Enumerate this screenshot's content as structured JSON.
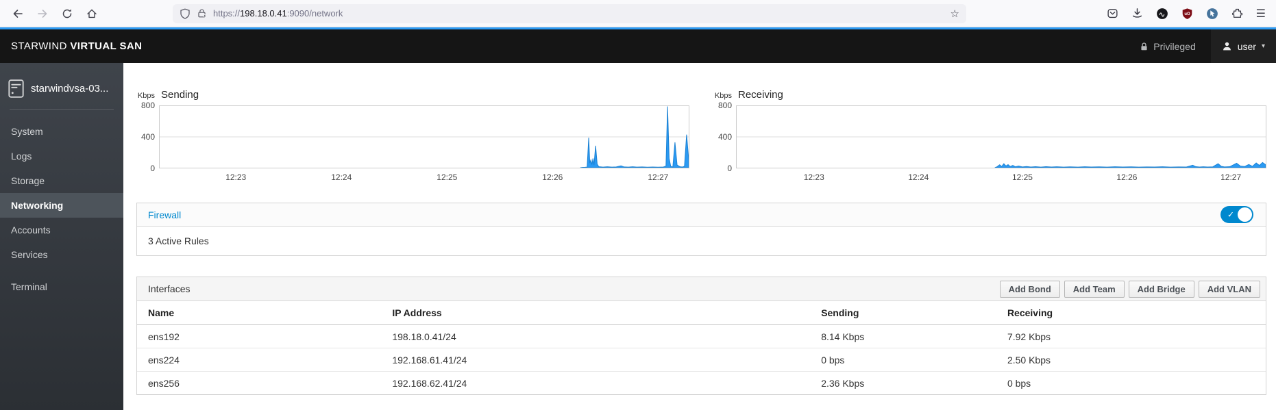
{
  "colors": {
    "accent": "#2b9af3",
    "chart_fill": "#2b9af3",
    "chart_stroke": "#1b82d4",
    "link": "#0088ce",
    "toggle_on": "#0088ce",
    "grid": "#dddddd"
  },
  "icons": {
    "star_glyph": "☆",
    "menu_glyph": "☰",
    "caret_glyph": "▾",
    "check_glyph": "✓"
  },
  "browser": {
    "url_prefix": "https://",
    "url_host": "198.18.0.41",
    "url_suffix": ":9090/network"
  },
  "masthead": {
    "brand_normal": "STARWIND",
    "brand_bold": "VIRTUAL SAN",
    "privileged_label": "Privileged",
    "user_label": "user"
  },
  "sidebar": {
    "hostname": "starwindvsa-03...",
    "items": [
      {
        "label": "System",
        "active": false
      },
      {
        "label": "Logs",
        "active": false
      },
      {
        "label": "Storage",
        "active": false
      },
      {
        "label": "Networking",
        "active": true
      },
      {
        "label": "Accounts",
        "active": false
      },
      {
        "label": "Services",
        "active": false
      },
      {
        "label": "Terminal",
        "active": false,
        "gap_before": true
      }
    ]
  },
  "firewall": {
    "title": "Firewall",
    "summary": "3 Active Rules",
    "toggle_on": true
  },
  "interfaces": {
    "title": "Interfaces",
    "buttons": [
      "Add Bond",
      "Add Team",
      "Add Bridge",
      "Add VLAN"
    ],
    "columns": [
      "Name",
      "IP Address",
      "Sending",
      "Receiving"
    ],
    "rows": [
      [
        "ens192",
        "198.18.0.41/24",
        "8.14 Kbps",
        "7.92 Kbps"
      ],
      [
        "ens224",
        "192.168.61.41/24",
        "0 bps",
        "2.50 Kbps"
      ],
      [
        "ens256",
        "192.168.62.41/24",
        "2.36 Kbps",
        "0 bps"
      ]
    ]
  },
  "chart_data": [
    {
      "type": "area",
      "title": "Sending",
      "unit": "Kbps",
      "ylabel": "Kbps",
      "ylim": [
        0,
        800
      ],
      "yticks": [
        0,
        400,
        800
      ],
      "grid": true,
      "legend": "none",
      "xticks": [
        {
          "label": "12:23",
          "f": 0.145
        },
        {
          "label": "12:24",
          "f": 0.344
        },
        {
          "label": "12:25",
          "f": 0.543
        },
        {
          "label": "12:26",
          "f": 0.742
        },
        {
          "label": "12:27",
          "f": 0.941
        }
      ],
      "series": [
        {
          "name": "Sending",
          "points": [
            [
              0.795,
              0
            ],
            [
              0.8,
              4
            ],
            [
              0.804,
              6
            ],
            [
              0.808,
              8
            ],
            [
              0.811,
              390
            ],
            [
              0.813,
              60
            ],
            [
              0.815,
              100
            ],
            [
              0.817,
              40
            ],
            [
              0.819,
              120
            ],
            [
              0.821,
              35
            ],
            [
              0.824,
              285
            ],
            [
              0.827,
              45
            ],
            [
              0.83,
              14
            ],
            [
              0.838,
              8
            ],
            [
              0.846,
              12
            ],
            [
              0.855,
              8
            ],
            [
              0.863,
              10
            ],
            [
              0.872,
              24
            ],
            [
              0.878,
              10
            ],
            [
              0.886,
              8
            ],
            [
              0.894,
              12
            ],
            [
              0.902,
              8
            ],
            [
              0.912,
              10
            ],
            [
              0.922,
              7
            ],
            [
              0.932,
              9
            ],
            [
              0.942,
              7
            ],
            [
              0.952,
              9
            ],
            [
              0.957,
              20
            ],
            [
              0.96,
              795
            ],
            [
              0.963,
              120
            ],
            [
              0.966,
              18
            ],
            [
              0.97,
              10
            ],
            [
              0.974,
              330
            ],
            [
              0.978,
              35
            ],
            [
              0.983,
              14
            ],
            [
              0.988,
              9
            ],
            [
              0.992,
              18
            ],
            [
              0.996,
              430
            ],
            [
              1.0,
              110
            ]
          ]
        }
      ]
    },
    {
      "type": "area",
      "title": "Receiving",
      "unit": "Kbps",
      "ylabel": "Kbps",
      "ylim": [
        0,
        800
      ],
      "yticks": [
        0,
        400,
        800
      ],
      "grid": true,
      "legend": "none",
      "xticks": [
        {
          "label": "12:23",
          "f": 0.147
        },
        {
          "label": "12:24",
          "f": 0.344
        },
        {
          "label": "12:25",
          "f": 0.54
        },
        {
          "label": "12:26",
          "f": 0.737
        },
        {
          "label": "12:27",
          "f": 0.933
        }
      ],
      "series": [
        {
          "name": "Receiving",
          "points": [
            [
              0.488,
              0
            ],
            [
              0.492,
              12
            ],
            [
              0.497,
              38
            ],
            [
              0.501,
              16
            ],
            [
              0.505,
              52
            ],
            [
              0.509,
              22
            ],
            [
              0.513,
              40
            ],
            [
              0.517,
              16
            ],
            [
              0.522,
              30
            ],
            [
              0.527,
              12
            ],
            [
              0.533,
              22
            ],
            [
              0.54,
              10
            ],
            [
              0.548,
              15
            ],
            [
              0.556,
              9
            ],
            [
              0.565,
              13
            ],
            [
              0.575,
              8
            ],
            [
              0.585,
              14
            ],
            [
              0.595,
              9
            ],
            [
              0.605,
              12
            ],
            [
              0.618,
              8
            ],
            [
              0.63,
              11
            ],
            [
              0.645,
              8
            ],
            [
              0.658,
              12
            ],
            [
              0.67,
              9
            ],
            [
              0.685,
              11
            ],
            [
              0.7,
              8
            ],
            [
              0.715,
              12
            ],
            [
              0.73,
              9
            ],
            [
              0.745,
              11
            ],
            [
              0.76,
              8
            ],
            [
              0.775,
              10
            ],
            [
              0.79,
              9
            ],
            [
              0.805,
              12
            ],
            [
              0.82,
              8
            ],
            [
              0.835,
              10
            ],
            [
              0.85,
              9
            ],
            [
              0.862,
              32
            ],
            [
              0.868,
              13
            ],
            [
              0.875,
              9
            ],
            [
              0.882,
              12
            ],
            [
              0.89,
              9
            ],
            [
              0.9,
              11
            ],
            [
              0.91,
              52
            ],
            [
              0.916,
              18
            ],
            [
              0.922,
              10
            ],
            [
              0.932,
              13
            ],
            [
              0.945,
              58
            ],
            [
              0.952,
              22
            ],
            [
              0.96,
              15
            ],
            [
              0.968,
              42
            ],
            [
              0.975,
              18
            ],
            [
              0.982,
              62
            ],
            [
              0.988,
              30
            ],
            [
              0.994,
              68
            ],
            [
              1.0,
              38
            ]
          ]
        }
      ]
    }
  ]
}
